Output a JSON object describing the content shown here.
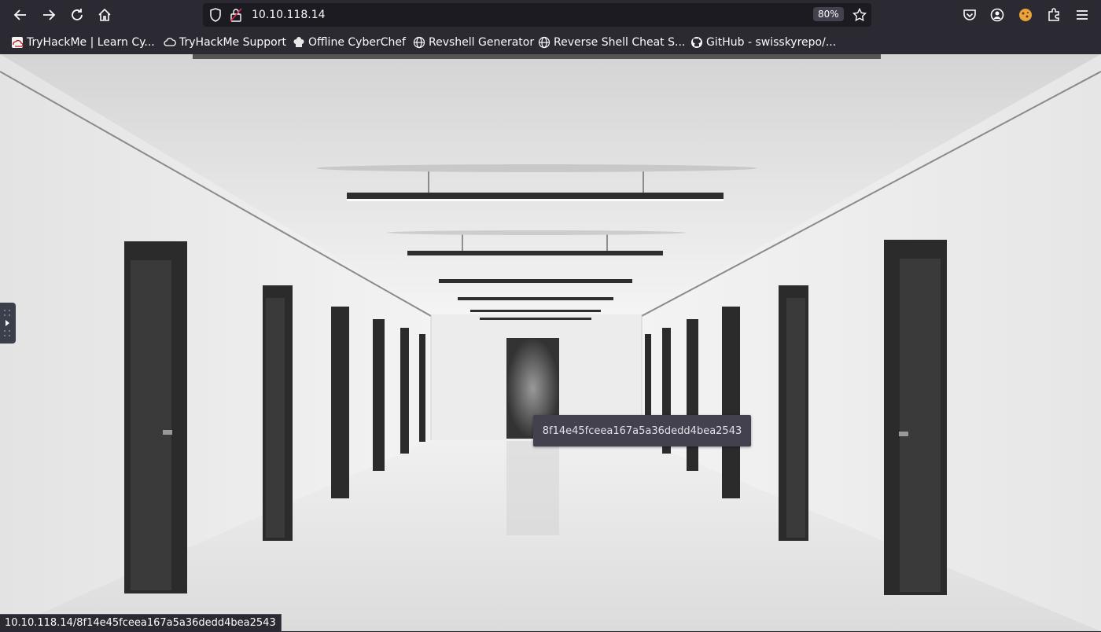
{
  "browser": {
    "url": "10.10.118.14",
    "zoom": "80%",
    "icons": {
      "back": "arrow-left-icon",
      "forward": "arrow-right-icon",
      "reload": "reload-icon",
      "home": "home-icon",
      "shield": "shield-icon",
      "lock": "insecure-lock-icon",
      "star": "star-icon",
      "pocket": "pocket-icon",
      "account": "account-icon",
      "extension1": "extension-badge-icon",
      "extensions": "puzzle-icon",
      "menu": "hamburger-menu-icon"
    }
  },
  "bookmarks": [
    {
      "label": "TryHackMe | Learn Cy...",
      "icon": "tryhackme-icon"
    },
    {
      "label": "TryHackMe Support",
      "icon": "cloud-icon"
    },
    {
      "label": "Offline CyberChef",
      "icon": "chef-hat-icon"
    },
    {
      "label": "Revshell Generator",
      "icon": "globe-icon"
    },
    {
      "label": "Reverse Shell Cheat S...",
      "icon": "globe-icon"
    },
    {
      "label": "GitHub - swisskyrepo/...",
      "icon": "github-icon"
    }
  ],
  "page": {
    "tooltip": "8f14e45fceea167a5a36dedd4bea2543",
    "image_alt": "corridor-image"
  },
  "status_bar": {
    "link": "10.10.118.14/8f14e45fceea167a5a36dedd4bea2543"
  },
  "colors": {
    "chrome_bg": "#2b2a33",
    "url_bg": "#1c1b22",
    "text": "#fbfbfe",
    "wall": "#e8e8e8",
    "door": "#2a2a2a"
  }
}
